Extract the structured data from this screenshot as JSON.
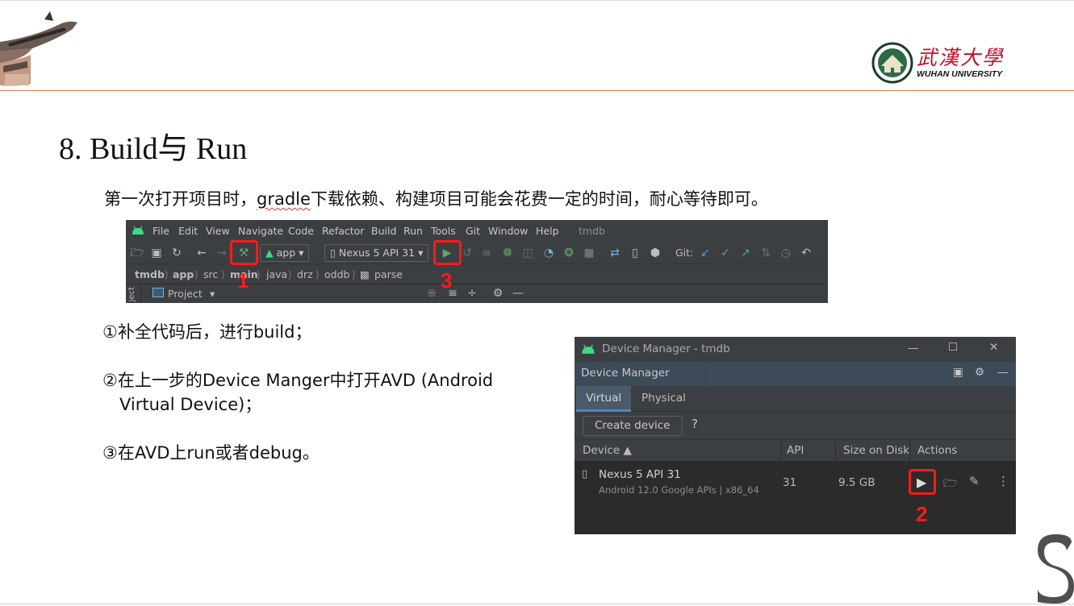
{
  "slide": {
    "title": "8. Build与 Run",
    "intro_prefix": "第一次打开项目时，",
    "intro_link": "gradle",
    "intro_suffix": "下载依赖、构建项目可能会花费一定的时间，耐心等待即可。",
    "step1": "①补全代码后，进行build；",
    "step2_line1": "②在上一步的Device Manger中打开AVD (Android",
    "step2_line2": "Virtual Device)；",
    "step3": "③在AVD上run或者debug。",
    "logo_cn": "武漢大學",
    "logo_en": "WUHAN UNIVERSITY"
  },
  "ide": {
    "menus": [
      "File",
      "Edit",
      "View",
      "Navigate",
      "Code",
      "Refactor",
      "Build",
      "Run",
      "Tools",
      "Git",
      "Window",
      "Help"
    ],
    "project_name": "tmdb",
    "run_config": "app",
    "device": "Nexus 5 API 31",
    "git_label": "Git:",
    "breadcrumbs": [
      "tmdb",
      "app",
      "src",
      "main",
      "java",
      "drz",
      "oddb",
      "parse"
    ],
    "project_tab": "Project",
    "side_label": "ject",
    "callouts": {
      "build": "1",
      "run": "3"
    },
    "colors": {
      "background": "#3c3f41",
      "run_green": "#59a869",
      "highlight": "#ff1a1a"
    }
  },
  "device_manager": {
    "window_title": "Device Manager - tmdb",
    "panel_title": "Device Manager",
    "tabs": [
      "Virtual",
      "Physical"
    ],
    "active_tab": "Virtual",
    "create_button": "Create device",
    "help": "?",
    "columns": [
      "Device ▲",
      "API",
      "Size on Disk",
      "Actions"
    ],
    "rows": [
      {
        "name": "Nexus 5 API 31",
        "detail": "Android 12.0 Google APIs | x86_64",
        "api": "31",
        "size": "9.5 GB"
      }
    ],
    "callout": "2",
    "window_controls": [
      "—",
      "☐",
      "✕"
    ]
  }
}
